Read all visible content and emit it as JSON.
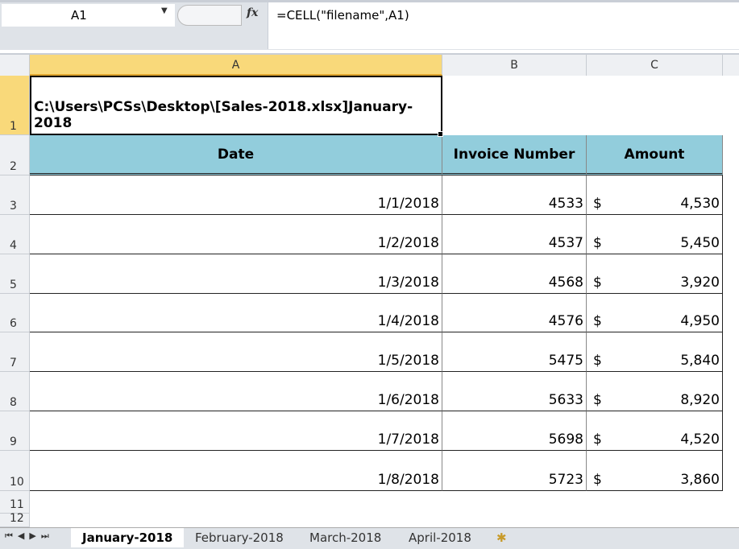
{
  "formula_bar": {
    "name_box": "A1",
    "fx": "fx",
    "formula": "=CELL(\"filename\",A1)"
  },
  "columns": [
    "A",
    "B",
    "C"
  ],
  "rows": [
    "1",
    "2",
    "3",
    "4",
    "5",
    "6",
    "7",
    "8",
    "9",
    "10",
    "11",
    "12"
  ],
  "a1": "C:\\Users\\PCSs\\Desktop\\[Sales-2018.xlsx]January-2018",
  "headers": [
    "Date",
    "Invoice Number",
    "Amount"
  ],
  "currency": "$",
  "data": [
    [
      "1/1/2018",
      "4533",
      "4,530"
    ],
    [
      "1/2/2018",
      "4537",
      "5,450"
    ],
    [
      "1/3/2018",
      "4568",
      "3,920"
    ],
    [
      "1/4/2018",
      "4576",
      "4,950"
    ],
    [
      "1/5/2018",
      "5475",
      "5,840"
    ],
    [
      "1/6/2018",
      "5633",
      "8,920"
    ],
    [
      "1/7/2018",
      "5698",
      "4,520"
    ],
    [
      "1/8/2018",
      "5723",
      "3,860"
    ]
  ],
  "sheet_tabs": [
    "January-2018",
    "February-2018",
    "March-2018",
    "April-2018"
  ],
  "active_tab": "January-2018",
  "colors": {
    "header_fill": "#92cddc",
    "selected_col_header": "#f9d97a"
  }
}
